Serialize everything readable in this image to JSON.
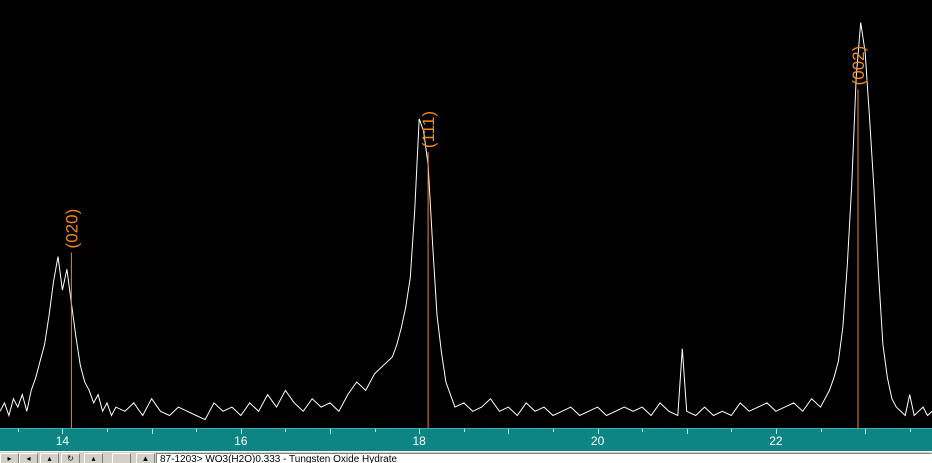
{
  "chart_data": {
    "type": "line",
    "xlim": [
      13.3,
      23.75
    ],
    "ylim": [
      0,
      100
    ],
    "x_ticks": [
      14,
      16,
      18,
      20,
      22
    ],
    "grid": false,
    "series": [
      {
        "values": [
          [
            13.3,
            4
          ],
          [
            13.35,
            6
          ],
          [
            13.4,
            3
          ],
          [
            13.45,
            7
          ],
          [
            13.5,
            5
          ],
          [
            13.55,
            8
          ],
          [
            13.6,
            4
          ],
          [
            13.65,
            9
          ],
          [
            13.7,
            12
          ],
          [
            13.75,
            16
          ],
          [
            13.8,
            20
          ],
          [
            13.85,
            27
          ],
          [
            13.9,
            35
          ],
          [
            13.95,
            41
          ],
          [
            14.0,
            33
          ],
          [
            14.05,
            38
          ],
          [
            14.1,
            30
          ],
          [
            14.15,
            22
          ],
          [
            14.2,
            15
          ],
          [
            14.25,
            11
          ],
          [
            14.3,
            9
          ],
          [
            14.35,
            6
          ],
          [
            14.4,
            8
          ],
          [
            14.45,
            4
          ],
          [
            14.5,
            6
          ],
          [
            14.55,
            3
          ],
          [
            14.6,
            5
          ],
          [
            14.7,
            4
          ],
          [
            14.8,
            6
          ],
          [
            14.9,
            3
          ],
          [
            15.0,
            7
          ],
          [
            15.1,
            4
          ],
          [
            15.2,
            3
          ],
          [
            15.3,
            5
          ],
          [
            15.4,
            4
          ],
          [
            15.5,
            3
          ],
          [
            15.6,
            2
          ],
          [
            15.7,
            6
          ],
          [
            15.8,
            4
          ],
          [
            15.9,
            5
          ],
          [
            16.0,
            3
          ],
          [
            16.1,
            6
          ],
          [
            16.2,
            4
          ],
          [
            16.3,
            8
          ],
          [
            16.4,
            5
          ],
          [
            16.5,
            9
          ],
          [
            16.6,
            6
          ],
          [
            16.7,
            4
          ],
          [
            16.8,
            7
          ],
          [
            16.9,
            5
          ],
          [
            17.0,
            6
          ],
          [
            17.1,
            4
          ],
          [
            17.2,
            8
          ],
          [
            17.3,
            11
          ],
          [
            17.4,
            9
          ],
          [
            17.5,
            13
          ],
          [
            17.6,
            15
          ],
          [
            17.7,
            17
          ],
          [
            17.75,
            20
          ],
          [
            17.8,
            24
          ],
          [
            17.85,
            29
          ],
          [
            17.9,
            36
          ],
          [
            17.95,
            52
          ],
          [
            18.0,
            74
          ],
          [
            18.05,
            71
          ],
          [
            18.1,
            63
          ],
          [
            18.15,
            44
          ],
          [
            18.2,
            27
          ],
          [
            18.25,
            18
          ],
          [
            18.3,
            11
          ],
          [
            18.35,
            8
          ],
          [
            18.4,
            5
          ],
          [
            18.5,
            6
          ],
          [
            18.6,
            4
          ],
          [
            18.7,
            5
          ],
          [
            18.8,
            7
          ],
          [
            18.9,
            4
          ],
          [
            19.0,
            5
          ],
          [
            19.1,
            3
          ],
          [
            19.2,
            6
          ],
          [
            19.3,
            4
          ],
          [
            19.4,
            5
          ],
          [
            19.5,
            3
          ],
          [
            19.6,
            4
          ],
          [
            19.7,
            5
          ],
          [
            19.8,
            3
          ],
          [
            19.9,
            4
          ],
          [
            20.0,
            5
          ],
          [
            20.1,
            3
          ],
          [
            20.2,
            4
          ],
          [
            20.3,
            5
          ],
          [
            20.4,
            4
          ],
          [
            20.5,
            5
          ],
          [
            20.6,
            3
          ],
          [
            20.7,
            6
          ],
          [
            20.8,
            4
          ],
          [
            20.9,
            3
          ],
          [
            20.95,
            19
          ],
          [
            21.0,
            4
          ],
          [
            21.1,
            3
          ],
          [
            21.2,
            5
          ],
          [
            21.3,
            3
          ],
          [
            21.4,
            4
          ],
          [
            21.5,
            3
          ],
          [
            21.6,
            6
          ],
          [
            21.7,
            4
          ],
          [
            21.8,
            5
          ],
          [
            21.9,
            6
          ],
          [
            22.0,
            4
          ],
          [
            22.1,
            5
          ],
          [
            22.2,
            6
          ],
          [
            22.3,
            4
          ],
          [
            22.4,
            7
          ],
          [
            22.5,
            5
          ],
          [
            22.6,
            9
          ],
          [
            22.65,
            12
          ],
          [
            22.7,
            16
          ],
          [
            22.75,
            24
          ],
          [
            22.8,
            39
          ],
          [
            22.85,
            58
          ],
          [
            22.9,
            84
          ],
          [
            22.95,
            97
          ],
          [
            23.0,
            90
          ],
          [
            23.05,
            74
          ],
          [
            23.1,
            57
          ],
          [
            23.15,
            37
          ],
          [
            23.2,
            20
          ],
          [
            23.25,
            12
          ],
          [
            23.3,
            7
          ],
          [
            23.35,
            5
          ],
          [
            23.4,
            4
          ],
          [
            23.45,
            3
          ],
          [
            23.5,
            8
          ],
          [
            23.55,
            3
          ],
          [
            23.6,
            4
          ],
          [
            23.65,
            5
          ],
          [
            23.7,
            3
          ],
          [
            23.75,
            4
          ]
        ]
      }
    ],
    "reference_lines": [
      {
        "label": "(020)",
        "x": 14.1,
        "height": 42
      },
      {
        "label": "(111)",
        "x": 18.1,
        "height": 66
      },
      {
        "label": "(002)",
        "x": 22.92,
        "height": 81
      }
    ]
  },
  "colors": {
    "background": "#000000",
    "trace": "#ffffff",
    "reference": "#f08a24",
    "axis_bar": "#0e8585"
  },
  "reference_pattern": "87-1203> WO3(H2O)0.333 - Tungsten Oxide Hydrate",
  "toolbar_icons": [
    "arrow-right-icon",
    "arrow-left-icon",
    "arrow-up-icon",
    "refresh-icon",
    "arrow-up-small-icon",
    "blank-icon",
    "scroll-up-icon"
  ]
}
